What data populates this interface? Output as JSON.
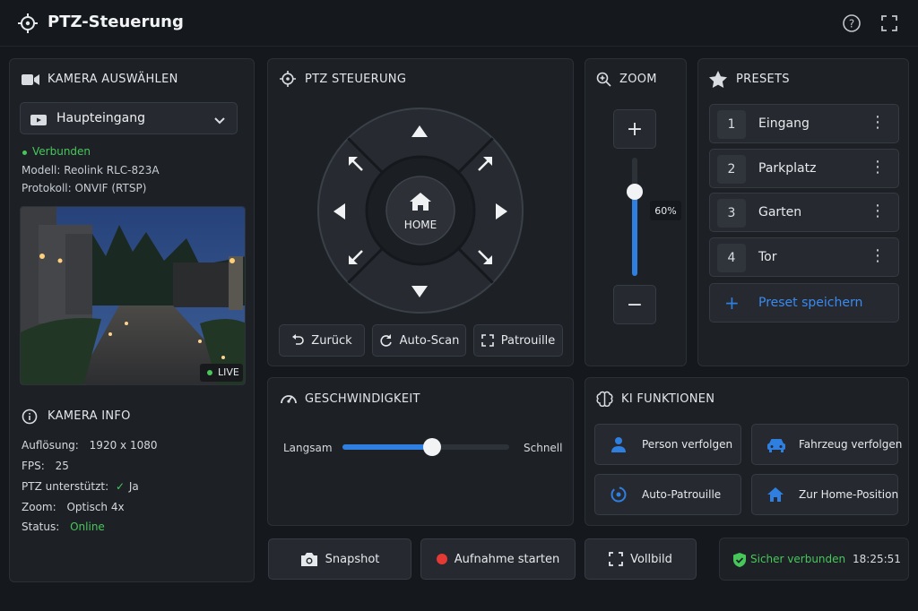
{
  "app": {
    "title": "PTZ-Steuerung"
  },
  "camera_select": {
    "title": "KAMERA AUSWÄHLEN",
    "selected": "Haupteingang",
    "status": "Verbunden",
    "model": "Modell: Reolink RLC-823A",
    "protocol": "Protokoll: ONVIF (RTSP)",
    "live_badge": "LIVE"
  },
  "camera_info": {
    "title": "KAMERA INFO",
    "rows": [
      {
        "label": "Auflösung:",
        "value": "1920 x 1080"
      },
      {
        "label": "FPS:",
        "value": "25"
      },
      {
        "label": "PTZ unterstützt:",
        "value": "Ja"
      },
      {
        "label": "Zoom:",
        "value": "Optisch 4x"
      },
      {
        "label": "Status:",
        "value": "Online"
      }
    ]
  },
  "ptz": {
    "title": "PTZ STEUERUNG",
    "home_label": "HOME",
    "buttons": {
      "back": "Zurück",
      "autoscan": "Auto-Scan",
      "patrol": "Patrouille"
    }
  },
  "zoom": {
    "title": "ZOOM",
    "level_text": "60%",
    "level": 0.6
  },
  "presets": {
    "title": "PRESETS",
    "items": [
      {
        "num": "1",
        "label": "Eingang"
      },
      {
        "num": "2",
        "label": "Parkplatz"
      },
      {
        "num": "3",
        "label": "Garten"
      },
      {
        "num": "4",
        "label": "Tor"
      }
    ],
    "save_label": "Preset speichern"
  },
  "speed": {
    "title": "GESCHWINDIGKEIT",
    "min_label": "Langsam",
    "max_label": "Schnell",
    "level": 0.54
  },
  "ai": {
    "title": "KI FUNKTIONEN",
    "person": "Person verfolgen",
    "vehicle": "Fahrzeug verfolgen",
    "patrol": "Auto-Patrouille",
    "home": "Zur Home-Position"
  },
  "actions": {
    "snapshot": "Snapshot",
    "record": "Aufnahme starten",
    "fullscreen": "Vollbild"
  },
  "status_bar": {
    "secure": "Sicher verbunden",
    "time": "18:25:51"
  },
  "colors": {
    "accent": "#2f7fe0",
    "green": "#47c75a",
    "red": "#e53935"
  }
}
